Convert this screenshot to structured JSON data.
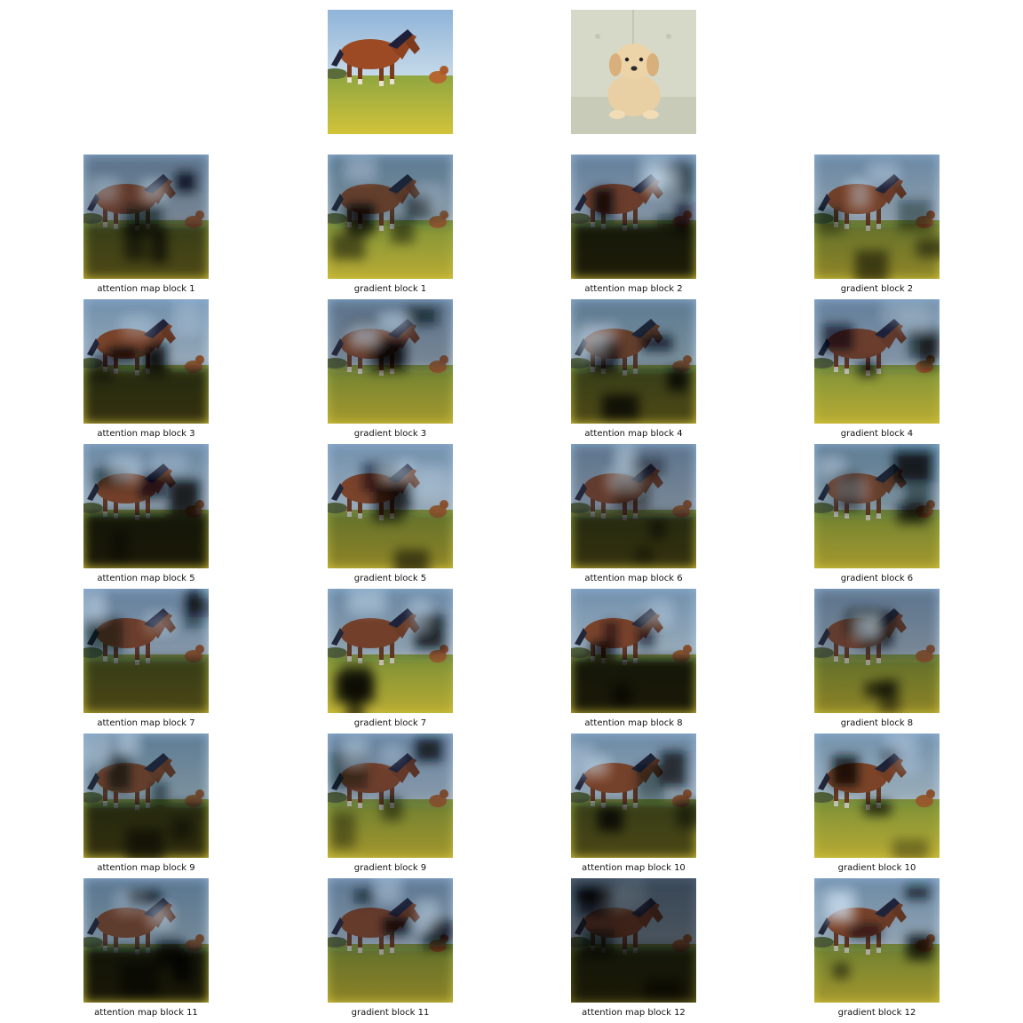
{
  "figure": {
    "input_images": [
      {
        "name": "horse-with-dog",
        "scene": "horse"
      },
      {
        "name": "puppy-on-couch",
        "scene": "puppy"
      }
    ],
    "panels": [
      {
        "label": "attention map block 1",
        "overlay": "attn1"
      },
      {
        "label": "gradient block 1",
        "overlay": "grad1"
      },
      {
        "label": "attention map block 2",
        "overlay": "attn2"
      },
      {
        "label": "gradient block 2",
        "overlay": "grad2"
      },
      {
        "label": "attention map block 3",
        "overlay": "attn3"
      },
      {
        "label": "gradient block 3",
        "overlay": "grad3"
      },
      {
        "label": "attention map block 4",
        "overlay": "attn4"
      },
      {
        "label": "gradient block 4",
        "overlay": "grad4"
      },
      {
        "label": "attention map block 5",
        "overlay": "attn5"
      },
      {
        "label": "gradient block 5",
        "overlay": "grad5"
      },
      {
        "label": "attention map block 6",
        "overlay": "attn6"
      },
      {
        "label": "gradient block 6",
        "overlay": "grad6"
      },
      {
        "label": "attention map block 7",
        "overlay": "attn7"
      },
      {
        "label": "gradient block 7",
        "overlay": "grad7"
      },
      {
        "label": "attention map block 8",
        "overlay": "attn8"
      },
      {
        "label": "gradient block 8",
        "overlay": "grad8"
      },
      {
        "label": "attention map block 9",
        "overlay": "attn9"
      },
      {
        "label": "gradient block 9",
        "overlay": "grad9"
      },
      {
        "label": "attention map block 10",
        "overlay": "attn10"
      },
      {
        "label": "gradient block 10",
        "overlay": "grad10"
      },
      {
        "label": "attention map block 11",
        "overlay": "attn11"
      },
      {
        "label": "gradient block 11",
        "overlay": "grad11"
      },
      {
        "label": "attention map block 12",
        "overlay": "attn12"
      },
      {
        "label": "gradient block 12",
        "overlay": "grad12"
      }
    ]
  }
}
